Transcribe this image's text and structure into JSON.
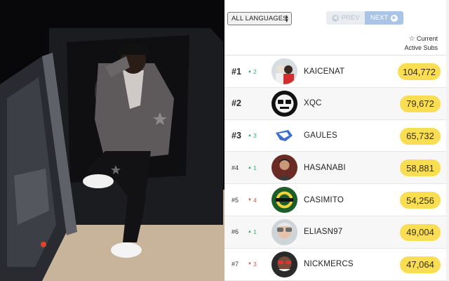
{
  "controls": {
    "language_select": "ALL LANGUAGES",
    "prev_label": "PREV",
    "next_label": "NEXT"
  },
  "column_header": {
    "line1": "Current",
    "line2": "Active Subs"
  },
  "icons": {
    "lang_chevron": "updown-chevron-icon",
    "prev": "arrow-left-circle-icon",
    "next": "arrow-right-circle-icon",
    "favorite": "star-outline-icon",
    "up": "triangle-up-icon",
    "down": "triangle-down-icon"
  },
  "colors": {
    "subs_badge": "#f9dd52",
    "up": "#3aa676",
    "down": "#d0564a",
    "next_button": "#a9c4e4"
  },
  "leaderboard": [
    {
      "rank": "#1",
      "change": "2",
      "direction": "up",
      "name": "KAICENAT",
      "subs": "104,772"
    },
    {
      "rank": "#2",
      "change": "",
      "direction": "none",
      "name": "XQC",
      "subs": "79,672"
    },
    {
      "rank": "#3",
      "change": "3",
      "direction": "up",
      "name": "GAULES",
      "subs": "65,732"
    },
    {
      "rank": "#4",
      "change": "1",
      "direction": "up",
      "name": "HASANABI",
      "subs": "58,881"
    },
    {
      "rank": "#5",
      "change": "4",
      "direction": "down",
      "name": "CASIMITO",
      "subs": "54,256"
    },
    {
      "rank": "#6",
      "change": "1",
      "direction": "up",
      "name": "ELIASN97",
      "subs": "49,004"
    },
    {
      "rank": "#7",
      "change": "3",
      "direction": "down",
      "name": "NICKMERCS",
      "subs": "47,064"
    }
  ]
}
